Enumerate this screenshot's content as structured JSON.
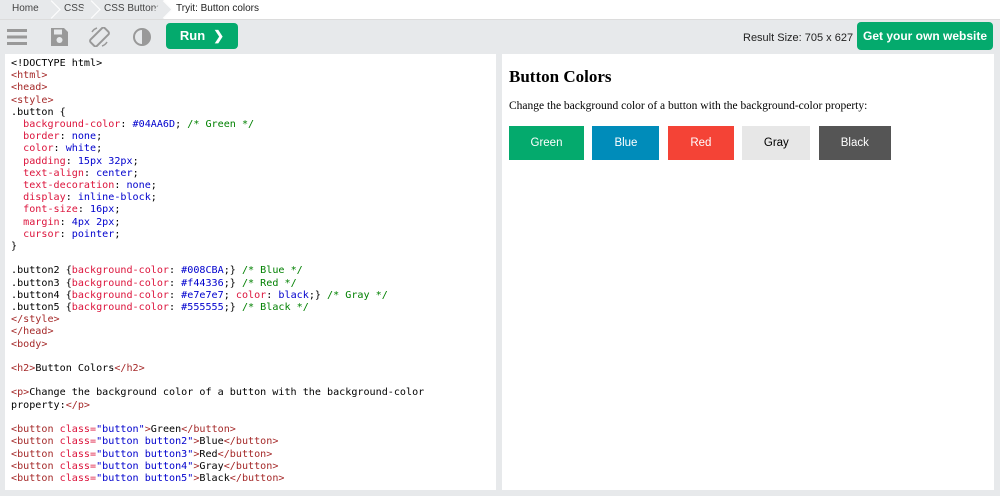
{
  "breadcrumb": [
    "Home",
    "CSS",
    "CSS Buttons",
    "Tryit: Button colors"
  ],
  "toolbar": {
    "run_label": "Run",
    "result_size": "Result Size: 705 x 627",
    "cta_label": "Get your own website"
  },
  "result": {
    "heading": "Button Colors",
    "paragraph": "Change the background color of a button with the background-color property:",
    "buttons": [
      {
        "label": "Green",
        "bg": "#04AA6D",
        "fg": "#ffffff"
      },
      {
        "label": "Blue",
        "bg": "#008CBA",
        "fg": "#ffffff"
      },
      {
        "label": "Red",
        "bg": "#f44336",
        "fg": "#ffffff"
      },
      {
        "label": "Gray",
        "bg": "#e7e7e7",
        "fg": "#000000"
      },
      {
        "label": "Black",
        "bg": "#555555",
        "fg": "#ffffff"
      }
    ]
  },
  "code_lines": [
    [
      [
        "t",
        "<!DOCTYPE html>"
      ]
    ],
    [
      [
        "tag",
        "<html>"
      ]
    ],
    [
      [
        "tag",
        "<head>"
      ]
    ],
    [
      [
        "tag",
        "<style>"
      ]
    ],
    [
      [
        "t",
        ".button {"
      ]
    ],
    [
      [
        "t",
        "  "
      ],
      [
        "prop",
        "background-color"
      ],
      [
        "t",
        ": "
      ],
      [
        "val",
        "#04AA6D"
      ],
      [
        "t",
        "; "
      ],
      [
        "cm",
        "/* Green */"
      ]
    ],
    [
      [
        "t",
        "  "
      ],
      [
        "prop",
        "border"
      ],
      [
        "t",
        ": "
      ],
      [
        "val",
        "none"
      ],
      [
        "t",
        ";"
      ]
    ],
    [
      [
        "t",
        "  "
      ],
      [
        "prop",
        "color"
      ],
      [
        "t",
        ": "
      ],
      [
        "val",
        "white"
      ],
      [
        "t",
        ";"
      ]
    ],
    [
      [
        "t",
        "  "
      ],
      [
        "prop",
        "padding"
      ],
      [
        "t",
        ": "
      ],
      [
        "val",
        "15px 32px"
      ],
      [
        "t",
        ";"
      ]
    ],
    [
      [
        "t",
        "  "
      ],
      [
        "prop",
        "text-align"
      ],
      [
        "t",
        ": "
      ],
      [
        "val",
        "center"
      ],
      [
        "t",
        ";"
      ]
    ],
    [
      [
        "t",
        "  "
      ],
      [
        "prop",
        "text-decoration"
      ],
      [
        "t",
        ": "
      ],
      [
        "val",
        "none"
      ],
      [
        "t",
        ";"
      ]
    ],
    [
      [
        "t",
        "  "
      ],
      [
        "prop",
        "display"
      ],
      [
        "t",
        ": "
      ],
      [
        "val",
        "inline-block"
      ],
      [
        "t",
        ";"
      ]
    ],
    [
      [
        "t",
        "  "
      ],
      [
        "prop",
        "font-size"
      ],
      [
        "t",
        ": "
      ],
      [
        "val",
        "16px"
      ],
      [
        "t",
        ";"
      ]
    ],
    [
      [
        "t",
        "  "
      ],
      [
        "prop",
        "margin"
      ],
      [
        "t",
        ": "
      ],
      [
        "val",
        "4px 2px"
      ],
      [
        "t",
        ";"
      ]
    ],
    [
      [
        "t",
        "  "
      ],
      [
        "prop",
        "cursor"
      ],
      [
        "t",
        ": "
      ],
      [
        "val",
        "pointer"
      ],
      [
        "t",
        ";"
      ]
    ],
    [
      [
        "t",
        "}"
      ]
    ],
    [
      [
        "t",
        ""
      ]
    ],
    [
      [
        "t",
        ".button2 {"
      ],
      [
        "prop",
        "background-color"
      ],
      [
        "t",
        ": "
      ],
      [
        "val",
        "#008CBA"
      ],
      [
        "t",
        ";} "
      ],
      [
        "cm",
        "/* Blue */"
      ]
    ],
    [
      [
        "t",
        ".button3 {"
      ],
      [
        "prop",
        "background-color"
      ],
      [
        "t",
        ": "
      ],
      [
        "val",
        "#f44336"
      ],
      [
        "t",
        ";} "
      ],
      [
        "cm",
        "/* Red */"
      ]
    ],
    [
      [
        "t",
        ".button4 {"
      ],
      [
        "prop",
        "background-color"
      ],
      [
        "t",
        ": "
      ],
      [
        "val",
        "#e7e7e7"
      ],
      [
        "t",
        "; "
      ],
      [
        "prop",
        "color"
      ],
      [
        "t",
        ": "
      ],
      [
        "val",
        "black"
      ],
      [
        "t",
        ";} "
      ],
      [
        "cm",
        "/* Gray */"
      ]
    ],
    [
      [
        "t",
        ".button5 {"
      ],
      [
        "prop",
        "background-color"
      ],
      [
        "t",
        ": "
      ],
      [
        "val",
        "#555555"
      ],
      [
        "t",
        ";} "
      ],
      [
        "cm",
        "/* Black */"
      ]
    ],
    [
      [
        "tag",
        "</style>"
      ]
    ],
    [
      [
        "tag",
        "</head>"
      ]
    ],
    [
      [
        "tag",
        "<body>"
      ]
    ],
    [
      [
        "t",
        ""
      ]
    ],
    [
      [
        "tag",
        "<h2>"
      ],
      [
        "t",
        "Button Colors"
      ],
      [
        "tag",
        "</h2>"
      ]
    ],
    [
      [
        "t",
        ""
      ]
    ],
    [
      [
        "tag",
        "<p>"
      ],
      [
        "t",
        "Change the background color of a button with the background-color"
      ]
    ],
    [
      [
        "t",
        "property:"
      ],
      [
        "tag",
        "</p>"
      ]
    ],
    [
      [
        "t",
        ""
      ]
    ],
    [
      [
        "tag",
        "<button"
      ],
      [
        "attr",
        " class="
      ],
      [
        "str",
        "\"button\""
      ],
      [
        "tag",
        ">"
      ],
      [
        "t",
        "Green"
      ],
      [
        "tag",
        "</button>"
      ]
    ],
    [
      [
        "tag",
        "<button"
      ],
      [
        "attr",
        " class="
      ],
      [
        "str",
        "\"button button2\""
      ],
      [
        "tag",
        ">"
      ],
      [
        "t",
        "Blue"
      ],
      [
        "tag",
        "</button>"
      ]
    ],
    [
      [
        "tag",
        "<button"
      ],
      [
        "attr",
        " class="
      ],
      [
        "str",
        "\"button button3\""
      ],
      [
        "tag",
        ">"
      ],
      [
        "t",
        "Red"
      ],
      [
        "tag",
        "</button>"
      ]
    ],
    [
      [
        "tag",
        "<button"
      ],
      [
        "attr",
        " class="
      ],
      [
        "str",
        "\"button button4\""
      ],
      [
        "tag",
        ">"
      ],
      [
        "t",
        "Gray"
      ],
      [
        "tag",
        "</button>"
      ]
    ],
    [
      [
        "tag",
        "<button"
      ],
      [
        "attr",
        " class="
      ],
      [
        "str",
        "\"button button5\""
      ],
      [
        "tag",
        ">"
      ],
      [
        "t",
        "Black"
      ],
      [
        "tag",
        "</button>"
      ]
    ]
  ]
}
